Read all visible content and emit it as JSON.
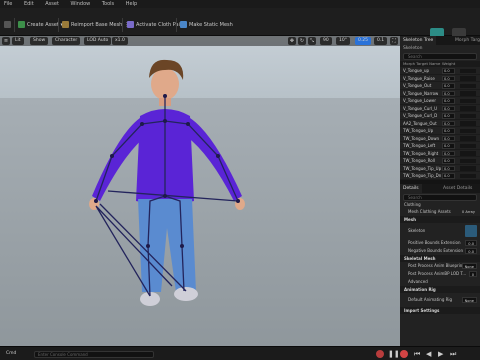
{
  "menu": {
    "items": [
      "File",
      "Edit",
      "Asset",
      "Window",
      "Tools",
      "Help"
    ]
  },
  "toolbar": {
    "create_asset": "Create Asset",
    "reimport": "Reimport Base Mesh",
    "activate_cloth": "Activate Cloth Paint",
    "make_static": "Make Static Mesh"
  },
  "viewport_toolbar": {
    "view": "Lit",
    "show": "Show",
    "character": "Character",
    "lod": "LOD Auto",
    "speed": "x1.0",
    "fov": "90",
    "snap": "10°",
    "scale": "0.25",
    "cam": "0.1"
  },
  "panel": {
    "tabs": [
      "Skeleton Tree",
      "Morph Target Preview"
    ],
    "tree_title": "Skeleton",
    "search_placeholder": "Search",
    "columns": {
      "name": "Morph Target Name",
      "weight": "Weight"
    },
    "morphs": [
      {
        "name": "V_Tongue_up",
        "weight": "0.0"
      },
      {
        "name": "V_Tongue_Raise",
        "weight": "0.0"
      },
      {
        "name": "V_Tongue_Out",
        "weight": "0.0"
      },
      {
        "name": "V_Tongue_Narrow",
        "weight": "0.0"
      },
      {
        "name": "V_Tongue_Lower",
        "weight": "0.0"
      },
      {
        "name": "V_Tongue_Curl_U",
        "weight": "0.0"
      },
      {
        "name": "V_Tongue_Curl_D",
        "weight": "0.0"
      },
      {
        "name": "AA2_Tongue_Out",
        "weight": "0.0"
      },
      {
        "name": "TW_Tongue_Up",
        "weight": "0.0"
      },
      {
        "name": "TW_Tongue_Down",
        "weight": "0.0"
      },
      {
        "name": "TW_Tongue_Left",
        "weight": "0.0"
      },
      {
        "name": "TW_Tongue_Right",
        "weight": "0.0"
      },
      {
        "name": "TW_Tongue_Roll",
        "weight": "0.0"
      },
      {
        "name": "TW_Tongue_Tip_Up",
        "weight": "0.0"
      },
      {
        "name": "TW_Tongue_Tip_Dn",
        "weight": "0.0"
      }
    ],
    "details_tabs": [
      "Details",
      "Asset Details"
    ],
    "details_search": "Search",
    "details": {
      "clothing_label": "Clothing",
      "mesh_clothing_assets": "Mesh Clothing Assets",
      "mesh_clothing_value": "0 Array",
      "mesh_cat": "Mesh",
      "skeleton": "Skeleton",
      "pos_bounds": "Positive Bounds Extension",
      "pos_bounds_val": "0.0",
      "neg_bounds": "Negative Bounds Extension",
      "neg_bounds_val": "0.0",
      "skel_mesh_cat": "Skeletal Mesh",
      "post_process": "Post Process Anim Blueprint",
      "post_process_val": "None",
      "post_process_lod": "Post Process AnimBP LOD T...",
      "post_process_lod_val": "0",
      "advanced": "Advanced",
      "anim_rig_cat": "Animation Rig",
      "default_anim_rig": "Default Animating Rig",
      "default_anim_rig_val": "None",
      "import_cat": "Import Settings"
    }
  },
  "bottom": {
    "cmd_label": "Cmd",
    "cmd_placeholder": "Enter Console Command"
  },
  "colors": {
    "accent": "#2a72d9",
    "green": "#3fa35a",
    "purple": "#5a24d6",
    "jeans": "#5a8bd0"
  }
}
